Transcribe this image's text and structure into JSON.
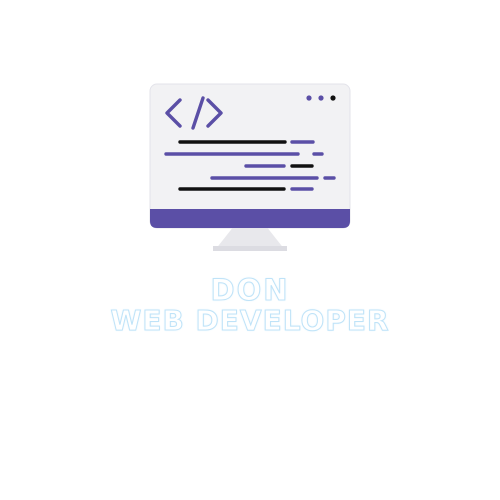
{
  "logo": {
    "name": "DON",
    "tagline": "WEB DEVELOPER",
    "code_tag_icon": "code-brackets-icon"
  },
  "colors": {
    "accent": "#5b4fa6",
    "screen": "#f2f2f4",
    "stand": "#e6e6ea",
    "code_dark": "#111111",
    "text_outline": "#bfe3f8"
  }
}
